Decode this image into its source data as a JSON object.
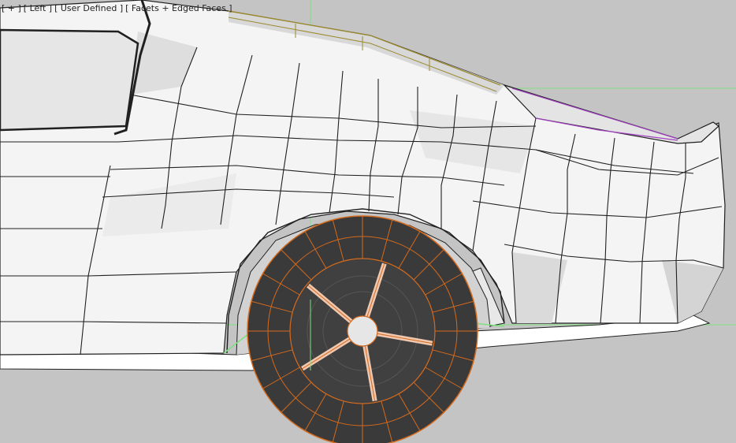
{
  "viewport": {
    "menus": {
      "plus": "[ + ]",
      "view": "[ Left ]",
      "shading": "[ User Defined ]",
      "display": "[ Facets + Edged Faces ]"
    }
  },
  "colors": {
    "background": "#c4c4c4",
    "mesh_face": "#f4f4f4",
    "mesh_shade": "#dedede",
    "mesh_edge": "#202020",
    "selected_edge": "#d46a1e",
    "tire": "#3a3a3a",
    "rim_spoke": "#f0c8b0",
    "grid_green": "#7fe07f",
    "grid_cyan": "#a8e0e0",
    "selection_purple": "#a040c0",
    "selection_olive": "#9a8a30"
  },
  "objects": [
    "car-body-mesh",
    "rear-wheel",
    "tire",
    "rim",
    "wheel-hub",
    "window-glass"
  ]
}
